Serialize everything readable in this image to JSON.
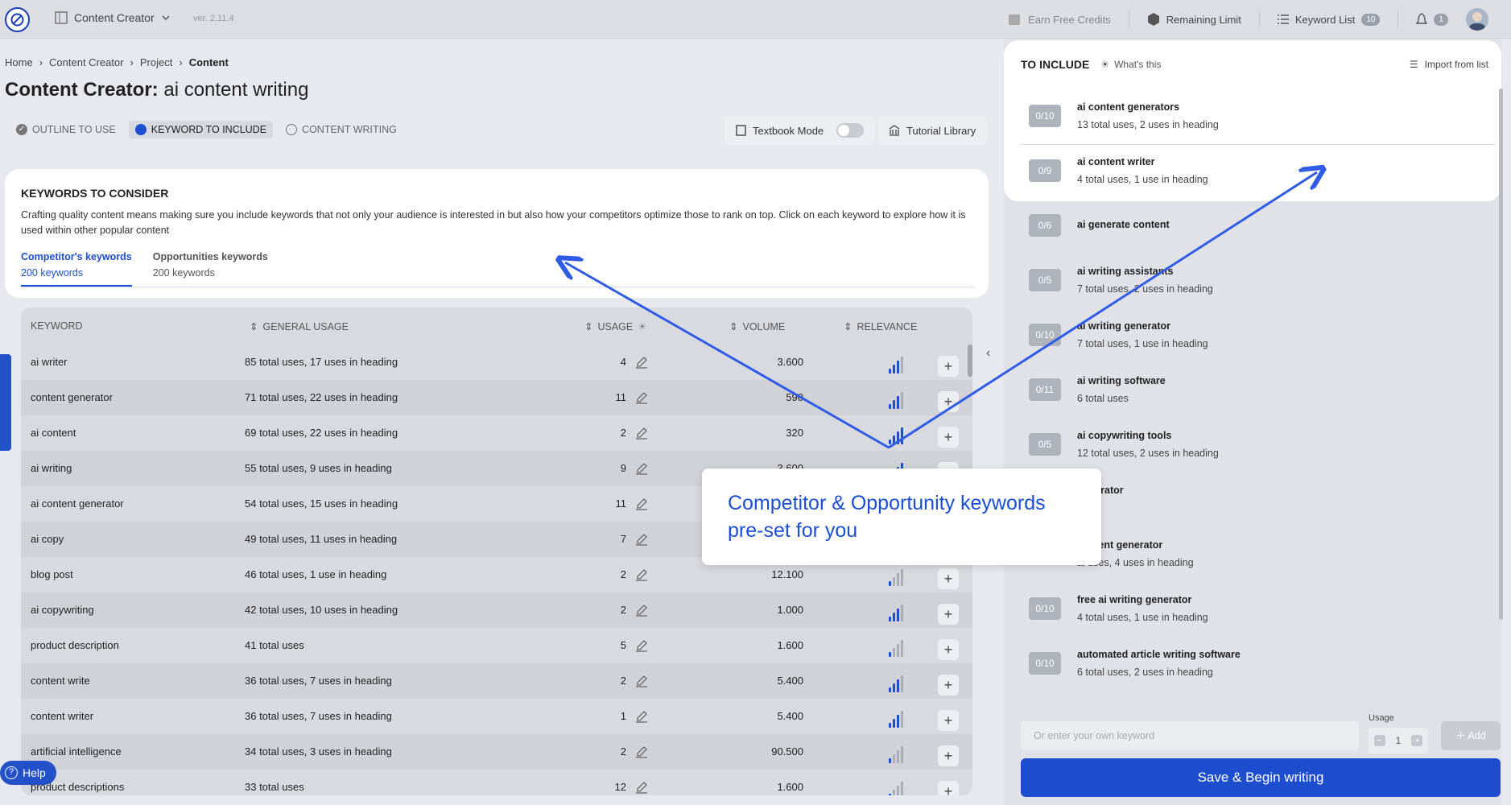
{
  "topbar": {
    "app_name": "Content Creator",
    "version": "ver. 2.11.4",
    "earn_credits": "Earn Free Credits",
    "remaining_limit": "Remaining Limit",
    "keyword_list": "Keyword List",
    "keyword_list_count": "10",
    "notifications_count": "1"
  },
  "breadcrumb": [
    "Home",
    "Content Creator",
    "Project",
    "Content"
  ],
  "page_title": {
    "prefix": "Content Creator:",
    "name": "ai content writing"
  },
  "steps": [
    {
      "label": "OUTLINE TO USE",
      "state": "done"
    },
    {
      "label": "KEYWORD TO INCLUDE",
      "state": "active"
    },
    {
      "label": "CONTENT WRITING",
      "state": "todo"
    }
  ],
  "textbook_mode": {
    "label": "Textbook Mode",
    "enabled": false
  },
  "tutorial_library": "Tutorial Library",
  "keywords_card": {
    "title": "KEYWORDS TO CONSIDER",
    "description": "Crafting quality content means making sure you include keywords that not only your audience is interested in but also how your competitors optimize those to rank on top. Click on each keyword to explore how it is used within other popular content",
    "tabs": [
      {
        "title": "Competitor's keywords",
        "sub": "200 keywords",
        "active": true
      },
      {
        "title": "Opportunities keywords",
        "sub": "200 keywords",
        "active": false
      }
    ]
  },
  "table": {
    "headers": {
      "keyword": "KEYWORD",
      "general_usage": "GENERAL USAGE",
      "usage": "USAGE",
      "volume": "VOLUME",
      "relevance": "RELEVANCE"
    },
    "rows": [
      {
        "keyword": "ai writer",
        "general": "85 total uses, 17 uses in heading",
        "usage": "4",
        "volume": "3.600",
        "relevance": 3
      },
      {
        "keyword": "content generator",
        "general": "71 total uses, 22 uses in heading",
        "usage": "11",
        "volume": "590",
        "relevance": 3
      },
      {
        "keyword": "ai content",
        "general": "69 total uses, 22 uses in heading",
        "usage": "2",
        "volume": "320",
        "relevance": 4
      },
      {
        "keyword": "ai writing",
        "general": "55 total uses, 9 uses in heading",
        "usage": "9",
        "volume": "3.600",
        "relevance": 4
      },
      {
        "keyword": "ai content generator",
        "general": "54 total uses, 15 uses in heading",
        "usage": "11",
        "volume": "",
        "relevance": 3
      },
      {
        "keyword": "ai copy",
        "general": "49 total uses, 11 uses in heading",
        "usage": "7",
        "volume": "",
        "relevance": 3
      },
      {
        "keyword": "blog post",
        "general": "46 total uses, 1 use in heading",
        "usage": "2",
        "volume": "12.100",
        "relevance": 1
      },
      {
        "keyword": "ai copywriting",
        "general": "42 total uses, 10 uses in heading",
        "usage": "2",
        "volume": "1.000",
        "relevance": 3
      },
      {
        "keyword": "product description",
        "general": "41 total uses",
        "usage": "5",
        "volume": "1.600",
        "relevance": 1
      },
      {
        "keyword": "content write",
        "general": "36 total uses, 7 uses in heading",
        "usage": "2",
        "volume": "5.400",
        "relevance": 3
      },
      {
        "keyword": "content writer",
        "general": "36 total uses, 7 uses in heading",
        "usage": "1",
        "volume": "5.400",
        "relevance": 3
      },
      {
        "keyword": "artificial intelligence",
        "general": "34 total uses, 3 uses in heading",
        "usage": "2",
        "volume": "90.500",
        "relevance": 1
      },
      {
        "keyword": "product descriptions",
        "general": "33 total uses",
        "usage": "12",
        "volume": "1.600",
        "relevance": 1
      }
    ]
  },
  "to_include": {
    "title": "TO INCLUDE",
    "whats_this": "What's this",
    "import": "Import from list",
    "items": [
      {
        "chip": "0/10",
        "name": "ai content generators",
        "sub": "13 total uses, 2 uses in heading"
      },
      {
        "chip": "0/9",
        "name": "ai content writer",
        "sub": "4 total uses, 1 use in heading"
      },
      {
        "chip": "0/6",
        "name": "ai generate content",
        "sub": ""
      },
      {
        "chip": "0/5",
        "name": "ai writing assistants",
        "sub": "7 total uses, 2 uses in heading"
      },
      {
        "chip": "0/10",
        "name": "ai writing generator",
        "sub": "7 total uses, 1 use in heading"
      },
      {
        "chip": "0/11",
        "name": "ai writing software",
        "sub": "6 total uses"
      },
      {
        "chip": "0/5",
        "name": "ai copywriting tools",
        "sub": "12 total uses, 2 uses in heading"
      },
      {
        "chip": "",
        "name": "generator",
        "sub": "uses"
      },
      {
        "chip": "",
        "name": "content generator",
        "sub": "al uses, 4 uses in heading"
      },
      {
        "chip": "0/10",
        "name": "free ai writing generator",
        "sub": "4 total uses, 1 use in heading"
      },
      {
        "chip": "0/10",
        "name": "automated article writing software",
        "sub": "6 total uses, 2 uses in heading"
      }
    ],
    "input_placeholder": "Or enter your own keyword",
    "usage_label": "Usage",
    "usage_value": "1",
    "add_label": "Add",
    "save_label": "Save & Begin writing"
  },
  "help": "Help",
  "callout": "Competitor & Opportunity keywords pre-set for you",
  "colors": {
    "accent": "#1d4ed0",
    "arrow": "#2f5be6"
  }
}
